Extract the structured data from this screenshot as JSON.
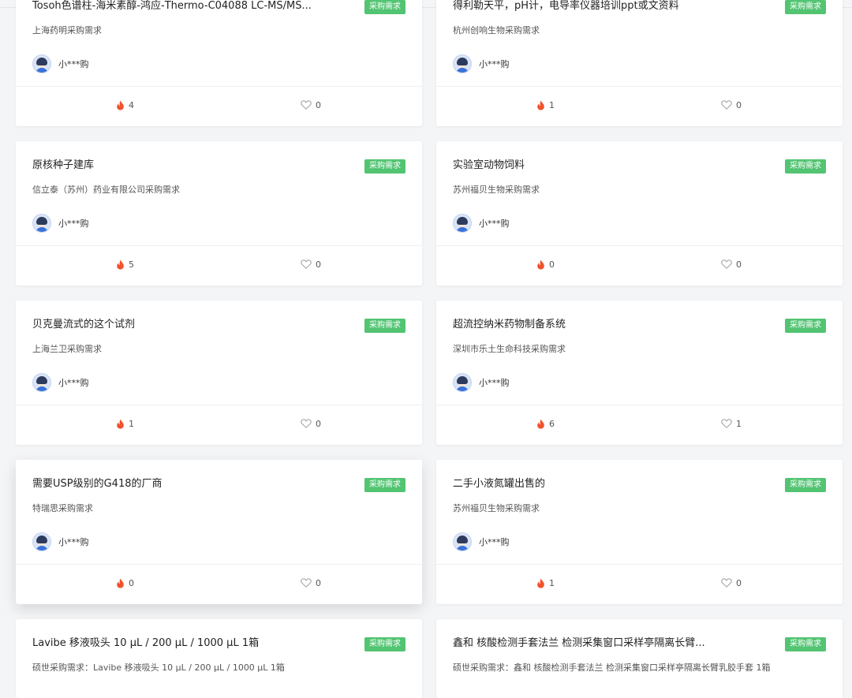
{
  "cards": [
    {
      "title": "Tosoh色谱柱-海米素醇-鸿应-Thermo-C04088 LC-MS/MS...",
      "tag": "采购需求",
      "company": "上海药明采购需求",
      "user": "小***购",
      "hot": "4",
      "fav": "0"
    },
    {
      "title": "得利勒天平，pH计，电导率仪器培训ppt或文资料",
      "tag": "采购需求",
      "company": "杭州创响生物采购需求",
      "user": "小***购",
      "hot": "1",
      "fav": "0"
    },
    {
      "title": "原核种子建库",
      "tag": "采购需求",
      "company": "信立泰（苏州）药业有限公司采购需求",
      "user": "小***购",
      "hot": "5",
      "fav": "0"
    },
    {
      "title": "实验室动物饲料",
      "tag": "采购需求",
      "company": "苏州福贝生物采购需求",
      "user": "小***购",
      "hot": "0",
      "fav": "0"
    },
    {
      "title": "贝克曼流式的这个试剂",
      "tag": "采购需求",
      "company": "上海兰卫采购需求",
      "user": "小***购",
      "hot": "1",
      "fav": "0"
    },
    {
      "title": "超流控纳米药物制备系统",
      "tag": "采购需求",
      "company": "深圳市乐土生命科技采购需求",
      "user": "小***购",
      "hot": "6",
      "fav": "1"
    },
    {
      "title": "需要USP级别的G418的厂商",
      "tag": "采购需求",
      "company": "特瑞思采购需求",
      "user": "小***购",
      "hot": "0",
      "fav": "0"
    },
    {
      "title": "二手小液氮罐出售的",
      "tag": "采购需求",
      "company": "苏州福贝生物采购需求",
      "user": "小***购",
      "hot": "1",
      "fav": "0"
    },
    {
      "title": "Lavibe 移液吸头 10 µL / 200 µL / 1000 µL 1箱",
      "tag": "采购需求",
      "company": "硕世采购需求：Lavibe 移液吸头 10 µL / 200 µL / 1000 µL 1箱",
      "user": "",
      "hot": "",
      "fav": ""
    },
    {
      "title": "鑫和 核酸检测手套法兰 检测采集窗口采样亭隔离长臂...",
      "tag": "采购需求",
      "company": "硕世采购需求：鑫和 核酸检测手套法兰 检测采集窗口采样亭隔离长臂乳胶手套 1箱",
      "user": "",
      "hot": "",
      "fav": ""
    }
  ],
  "icons": {
    "hot": "flame-icon",
    "fav": "heart-icon",
    "avatar": "user-avatar"
  },
  "colors": {
    "tag": "#52c472",
    "hot": "#f0522c"
  }
}
